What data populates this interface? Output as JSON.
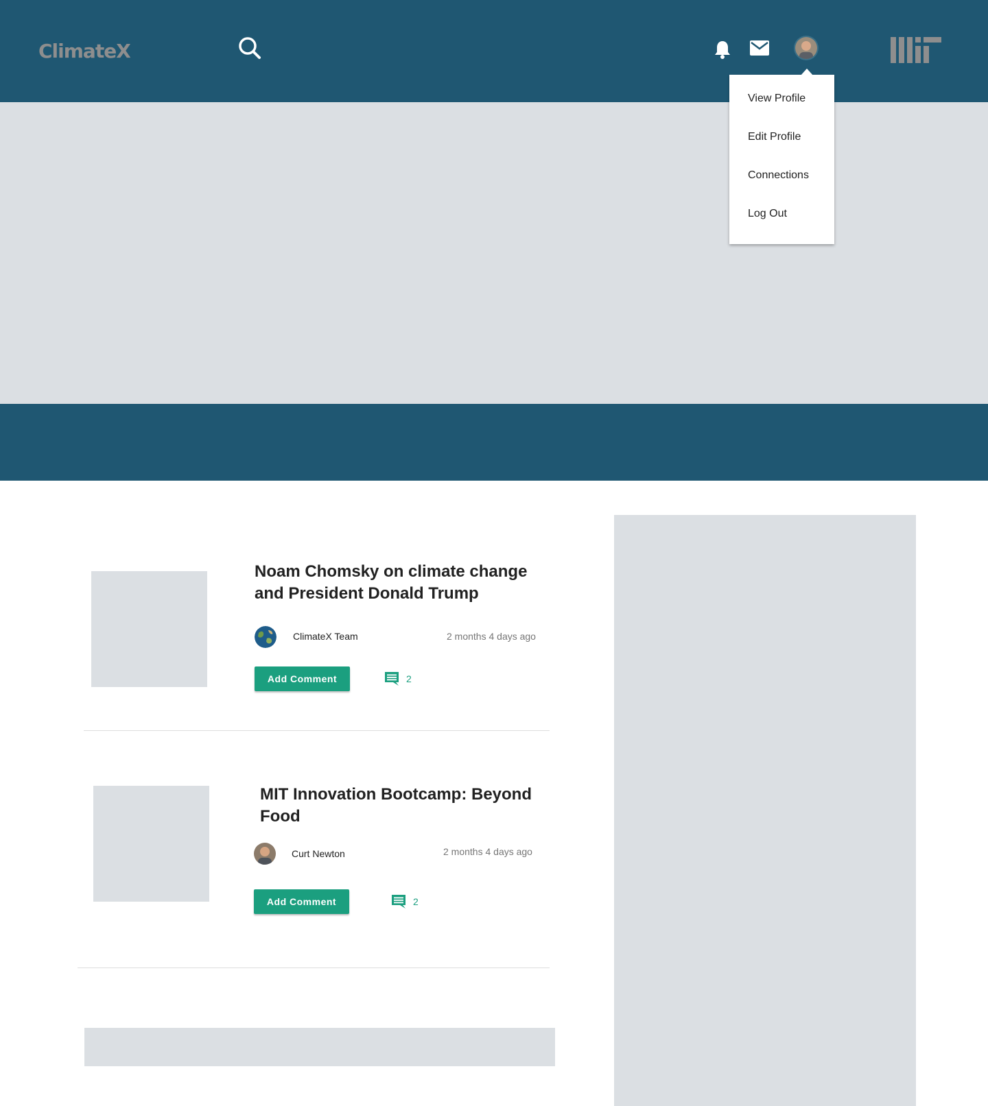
{
  "header": {
    "logo": "ClimateX",
    "icons": {
      "search": "search-icon",
      "notifications": "bell-icon",
      "messages": "mail-icon",
      "avatar": "user-avatar",
      "brand": "mit-logo"
    }
  },
  "profile_menu": {
    "items": [
      {
        "label": "View Profile"
      },
      {
        "label": "Edit Profile"
      },
      {
        "label": "Connections"
      },
      {
        "label": "Log Out"
      }
    ]
  },
  "posts": [
    {
      "title": "Noam Chomsky on climate change and President Donald Trump",
      "author": "ClimateX Team",
      "time": "2 months 4 days ago",
      "button": "Add Comment",
      "comment_count": "2"
    },
    {
      "title": "MIT Innovation Bootcamp: Beyond Food",
      "author": "Curt Newton",
      "time": "2 months 4 days ago",
      "button": "Add Comment",
      "comment_count": "2"
    }
  ],
  "colors": {
    "header_bg": "#1f5772",
    "placeholder": "#dbdfe3",
    "accent": "#1b9f7f"
  }
}
